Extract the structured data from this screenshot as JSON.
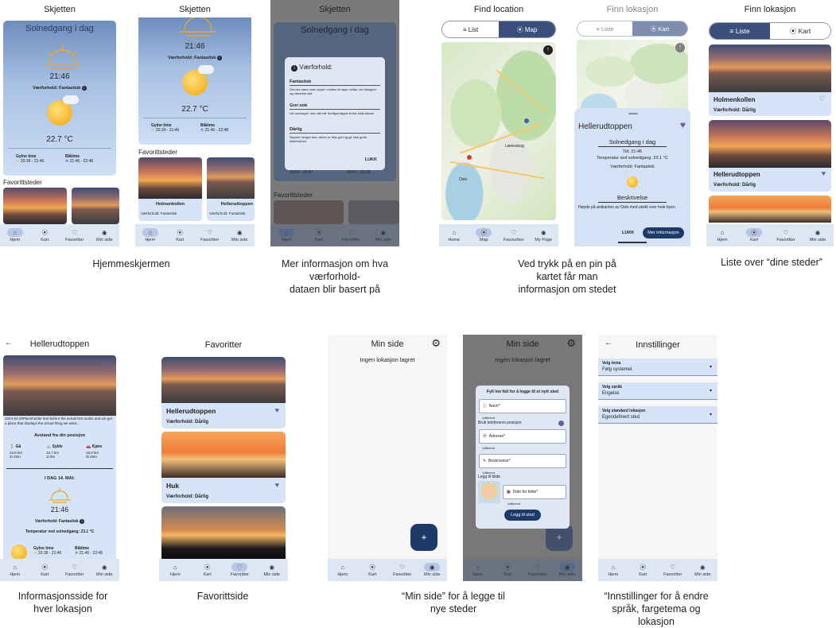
{
  "captions": {
    "home": "Hjemmeskjermen",
    "info": [
      "Mer informasjon om hva",
      "værforhold-",
      "dataen blir basert på"
    ],
    "pin": [
      "Ved trykk på en pin på",
      "kartet får man",
      "informasjon om stedet"
    ],
    "list": "Liste over “dine steder”",
    "detail": [
      "Informasjonsside for",
      "hver lokasjon"
    ],
    "favs": "Favorittside",
    "mypage": [
      "“Min side” for å legge til",
      "nye steder"
    ],
    "settings": [
      "“Innstillinger for å endre",
      "språk, fargetema og",
      "lokasjon"
    ]
  },
  "nav_no": [
    "Hjem",
    "Kart",
    "Favoritter",
    "Min side"
  ],
  "nav_en": [
    "Home",
    "Map",
    "Favourites",
    "My Page"
  ],
  "icons": [
    "home-icon",
    "map-pin-icon",
    "heart-icon",
    "account-icon"
  ],
  "home": {
    "title": "Skjetten",
    "card_title": "Solnedgang i dag",
    "time": "21:46",
    "weather_label": "Værforhold: Fantastisk",
    "temp": "22.7 °C",
    "golden_label": "Gylne time",
    "golden_val": "20:39 - 21:46",
    "blue_label": "Blåtime",
    "blue_val": "21:46 - 22:48",
    "favorites": "Favorittsteder"
  },
  "scrolled": {
    "card1_name": "Holmenkollen",
    "card1_weather": "Værforhold: Fantastisk",
    "card2_name": "Hellerudtoppen",
    "card2_weather": "Værforhold: Fantastisk"
  },
  "dialog": {
    "title": "Værforhold:",
    "s1_title": "Fantastisk",
    "s1_text": "Det ber nære noen skyer i midten til høye nivåer, lav fuktighet og utmerket sikt",
    "s2_title": "Grei nok",
    "s2_text": "Litt overskyet, men det blir forhåpentligvis et fint bilde likevel",
    "s3_title": "Dårlig",
    "s3_text": "Skyene henger lavt, sikten er ikke god og gir ikke gode bildeforhold",
    "close": "LUKK",
    "bg_left": "19:53 - 20:47",
    "bg_right": "20:47 - 21:39"
  },
  "findmap": {
    "title": "Find location",
    "tab_list": "List",
    "tab_map": "Map",
    "city": "Lørenskog",
    "city2": "Oslo"
  },
  "pininfo": {
    "title": "Finn lokasjon",
    "tab_list": "Liste",
    "tab_map": "Kart",
    "place": "Hellerudtoppen",
    "sunset": "Solnedgang i dag",
    "time": "Tid: 21:46",
    "temp": "Temperatur ved solnedgang: 23.1 °C",
    "weather": "Værforhold: Fantastisk",
    "desc_title": "Beskrivelse",
    "desc_text": "Høyde på østkanten av Oslo med utsikt over hele byen",
    "close": "LUKK",
    "more": "Mer informasjon"
  },
  "list": {
    "title": "Finn lokasjon",
    "tab_list": "Liste",
    "tab_map": "Kart",
    "item1_name": "Holmenkollen",
    "item1_weather": "Værforhold: Dårlig",
    "item2_name": "Hellerudtoppen",
    "item2_weather": "Værforhold: Dårlig"
  },
  "detail": {
    "title": "Hellerudtoppen",
    "desc": "2024-04-20Placeholder text before the actual text works and we get a place that displays the actual thing we want...",
    "distance_title": "Avstand fra din posisjon",
    "walk_label": "Gå",
    "walk_km": "13,6 km",
    "walk_time": "2t 23m",
    "bike_label": "Sykle",
    "bike_km": "12,7 km",
    "bike_time": "1t 9m",
    "car_label": "Kjøre",
    "car_km": "15,0 km",
    "car_time": "0t 26m",
    "today": "I DAG 14. MAI:",
    "time": "21:46",
    "weather": "Værforhold: Fantastisk",
    "temp": "Temperatur ved solnedgang: 23.1 °C",
    "golden_label": "Gylne time",
    "golden_val": "20:39 - 21:46",
    "blue_label": "Blåtime",
    "blue_val": "21:46 - 22:48"
  },
  "favs": {
    "title": "Favoritter",
    "item1_name": "Hellerudtoppen",
    "item1_weather": "Værforhold: Dårlig",
    "item2_name": "Huk",
    "item2_weather": "Værforhold: Dårlig"
  },
  "mypage": {
    "title": "Min side",
    "empty": "Ingen lokasjon lagret",
    "fab": "+"
  },
  "addform": {
    "title": "Min side",
    "empty": "Ingen lokasjon lagret",
    "form_title": "Fyll inn felt for å legge til et nytt sted",
    "name_ph": "Navn*",
    "required": "*påkrevd",
    "use_phone": "Bruk telefonens posisjon",
    "address_ph": "Adresse*",
    "desc_ph": "Beskrivelse*",
    "add_image": "Legg til bilde",
    "date_ph": "Dato for bilde*",
    "submit": "Legg til sted"
  },
  "settings": {
    "title": "Innstillinger",
    "theme_label": "Velg tema",
    "theme_val": "Følg systemet",
    "lang_label": "Velg språk",
    "lang_val": "Engelsk",
    "loc_label": "Velg standard lokasjon",
    "loc_val": "Egendefinert sted"
  },
  "colors": {
    "accent": "#1e3a6b",
    "heart": "#6c5a9c",
    "nav": "#dde6f3",
    "card": "#d7e4f7"
  }
}
